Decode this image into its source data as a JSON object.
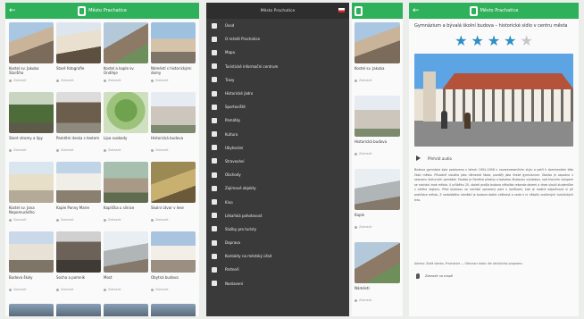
{
  "app": {
    "title": "Město Prachatice"
  },
  "list_screen": {
    "items": [
      {
        "title": "Kostel sv. Jakuba Staršího",
        "meta": "Zobrazit"
      },
      {
        "title": "Staré fotografie",
        "meta": "Zobrazit"
      },
      {
        "title": "Kostel a kaple sv. Ondřeje",
        "meta": "Zobrazit"
      },
      {
        "title": "Náměstí s historickými domy",
        "meta": "Zobrazit"
      },
      {
        "title": "Staré stromy a lípy",
        "meta": "Zobrazit"
      },
      {
        "title": "Pamětní deska s textem",
        "meta": "Zobrazit"
      },
      {
        "title": "Lípa svobody",
        "meta": "Zobrazit"
      },
      {
        "title": "Historická budova",
        "meta": "Zobrazit"
      },
      {
        "title": "Kostel sv. Jana Nepomuckého",
        "meta": "Zobrazit"
      },
      {
        "title": "Kaple Panny Marie",
        "meta": "Zobrazit"
      },
      {
        "title": "Kaplička u silnice",
        "meta": "Zobrazit"
      },
      {
        "title": "Skalní útvar v lese",
        "meta": "Zobrazit"
      },
      {
        "title": "Budova školy",
        "meta": "Zobrazit"
      },
      {
        "title": "Socha a pomník",
        "meta": "Zobrazit"
      },
      {
        "title": "Most",
        "meta": "Zobrazit"
      },
      {
        "title": "Obytná budova",
        "meta": "Zobrazit"
      }
    ]
  },
  "drawer": {
    "title": "Město Prachatice",
    "items": [
      "Úvod",
      "O městě Prachatice",
      "Mapa",
      "Turistické informační centrum",
      "Trasy",
      "Historické jádro",
      "Sportoviště",
      "Památky",
      "Kultura",
      "Ubytování",
      "Stravování",
      "Obchody",
      "Zajímavé objekty",
      "Kino",
      "Lékařská pohotovost",
      "Služby pro turisty",
      "Doprava",
      "Kontakty na městský úřad",
      "Partneři",
      "Nastavení"
    ],
    "preview_items": [
      {
        "title": "Kostel sv. Jakuba",
        "meta": "Zobrazit"
      },
      {
        "title": "Historická budova",
        "meta": "Zobrazit"
      },
      {
        "title": "Kaple",
        "meta": "Zobrazit"
      },
      {
        "title": "Náměstí",
        "meta": "Zobrazit"
      }
    ]
  },
  "detail": {
    "title": "Gymnázium a bývalá školní budova – historické sídlo v centru města",
    "rating": 4,
    "rating_max": 5,
    "audio_label": "Přehrát audio",
    "description": "Budova gymnázia byla postavena v letech 1904–1906 v novorenesančním stylu a patří k dominantám této části města. Původně sloužila jako německá škola, později jako české gymnázium. Stavba je zapsána v seznamu kulturních památek. Fasáda je členěná pilastry a bohatou štukovou výzdobou, nad hlavním vstupem se nachází znak města. V průběhu 20. století prošla budova několika rekonstrukcemi a dnes slouží studentům z celého regionu. Před budovou se nachází upravený park s lavičkami, kde je možné odpočinout si při prohlídce města. Z nedalekého náměstí je budova dobře viditelná a vede k ní několik značených turistických tras.",
    "info": "Adresa: Zlatá stezka, Prachatice — Otevírací doba: dle aktuálního programu",
    "map_label": "Zobrazit na mapě"
  }
}
